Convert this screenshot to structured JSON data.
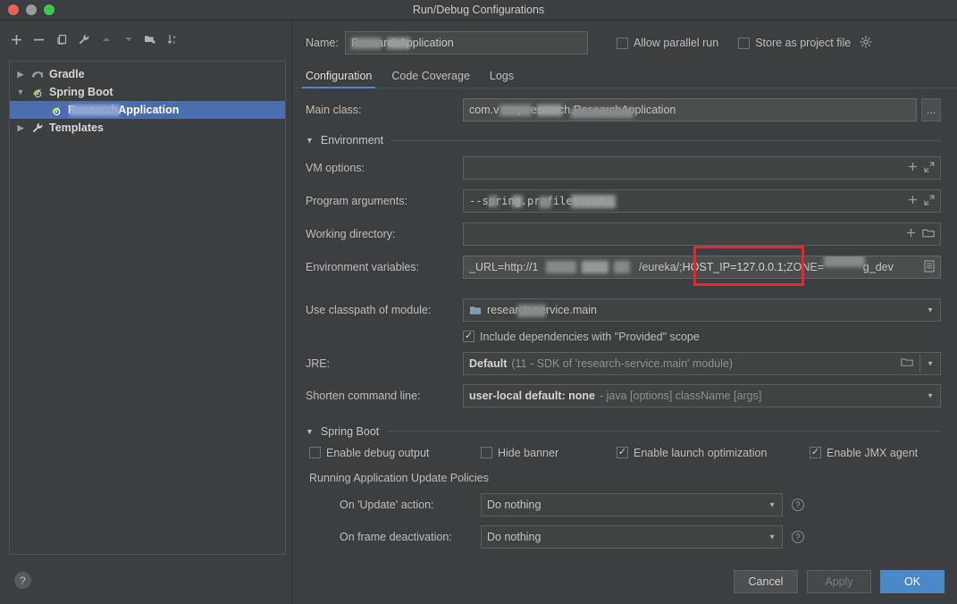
{
  "window": {
    "title": "Run/Debug Configurations",
    "traffic_lights": [
      "close-red",
      "minimize-gray",
      "zoom-green"
    ]
  },
  "sidebar": {
    "toolbar": [
      {
        "name": "add",
        "glyph": "+"
      },
      {
        "name": "remove",
        "glyph": "−"
      },
      {
        "name": "copy",
        "glyph": "copy"
      },
      {
        "name": "edit-templates",
        "glyph": "wrench"
      },
      {
        "name": "move-up",
        "glyph": "▲"
      },
      {
        "name": "move-down",
        "glyph": "▼"
      },
      {
        "name": "new-folder",
        "glyph": "folder-add"
      },
      {
        "name": "sort-alphabetically",
        "glyph": "sort-az"
      }
    ],
    "tree": [
      {
        "label": "Gradle",
        "icon": "gradle-icon",
        "expanded": false,
        "level": 0,
        "selected": false
      },
      {
        "label": "Spring Boot",
        "icon": "spring-boot-icon",
        "expanded": true,
        "level": 0,
        "selected": false
      },
      {
        "label": "ResearchApplication",
        "icon": "spring-boot-icon",
        "level": 1,
        "selected": true,
        "blurred": true
      },
      {
        "label": "Templates",
        "icon": "wrench-icon",
        "expanded": false,
        "level": 0,
        "selected": false
      }
    ],
    "help_label": "?"
  },
  "header": {
    "name_label": "Name:",
    "name_value": "ResearchApplication",
    "allow_parallel_run": {
      "label": "Allow parallel run",
      "checked": false
    },
    "store_as_project_file": {
      "label": "Store as project file",
      "checked": false
    },
    "gear_icon": "gear-icon"
  },
  "tabs": [
    {
      "label": "Configuration",
      "active": true
    },
    {
      "label": "Code Coverage",
      "active": false
    },
    {
      "label": "Logs",
      "active": false
    }
  ],
  "form": {
    "main_class": {
      "label": "Main class:",
      "value": "com.v   corp.research.ResearchApplication",
      "browse_label": "..."
    },
    "environment_section": {
      "label": "Environment",
      "expanded": true
    },
    "vm_options": {
      "label": "VM options:",
      "value": "",
      "icons": [
        "plus-icon",
        "expand-icon"
      ]
    },
    "program_arguments": {
      "label": "Program arguments:",
      "value": "--spring.profiles.act",
      "icons": [
        "plus-icon",
        "expand-icon"
      ]
    },
    "working_directory": {
      "label": "Working directory:",
      "value": "",
      "icons": [
        "plus-icon",
        "folder-icon"
      ]
    },
    "environment_variables": {
      "label": "Environment variables:",
      "value_prefix": "_URL=http://1",
      "value_mid": "/eureka/;",
      "value_highlight": "HOST_IP=127.0.0.1;",
      "value_suffix": "ZONE=",
      "value_tail": "g_dev",
      "icons": [
        "browse-list-icon"
      ]
    },
    "use_classpath_of_module": {
      "label": "Use classpath of module:",
      "value": "research-service.main",
      "icon": "module-icon"
    },
    "include_provided_scope": {
      "label": "Include dependencies with \"Provided\" scope",
      "checked": true
    },
    "jre": {
      "label": "JRE:",
      "value": "Default",
      "value_detail": "(11 - SDK of 'research-service.main' module)",
      "icons": [
        "folder-icon",
        "chevron-down-icon"
      ]
    },
    "shorten_command_line": {
      "label": "Shorten command line:",
      "value": "user-local default: none",
      "value_detail": "- java [options] className [args]"
    }
  },
  "spring_boot": {
    "section_label": "Spring Boot",
    "checkboxes": [
      {
        "label": "Enable debug output",
        "checked": false
      },
      {
        "label": "Hide banner",
        "checked": false
      },
      {
        "label": "Enable launch optimization",
        "checked": true
      },
      {
        "label": "Enable JMX agent",
        "checked": true
      }
    ],
    "update_policies_label": "Running Application Update Policies",
    "on_update_action": {
      "label": "On 'Update' action:",
      "value": "Do nothing",
      "help": "?"
    },
    "on_frame_deactivation": {
      "label": "On frame deactivation:",
      "value": "Do nothing",
      "help": "?"
    }
  },
  "footer": {
    "cancel": "Cancel",
    "apply": "Apply",
    "ok": "OK",
    "apply_enabled": false
  },
  "annotation": {
    "color": "#e8252a",
    "target_text": "HOST_IP=127.0.0.1;"
  }
}
